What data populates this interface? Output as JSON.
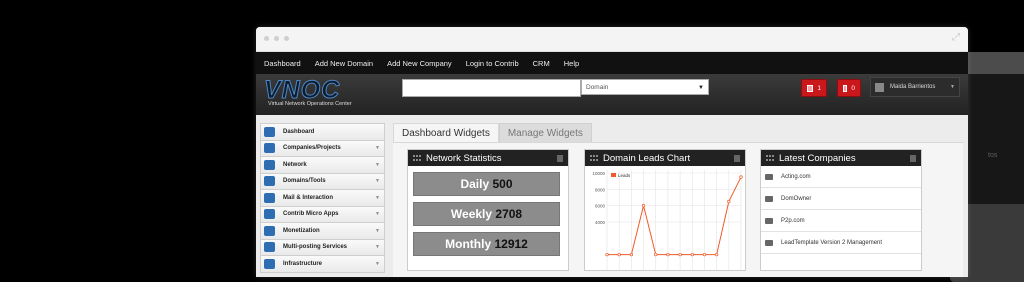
{
  "nav": [
    "Dashboard",
    "Add New Domain",
    "Add New Company",
    "Login to Contrib",
    "CRM",
    "Help"
  ],
  "logo": {
    "title": "VNOC",
    "subtitle": "Virtual Network Operations Center"
  },
  "header": {
    "select_value": "Domain",
    "badge1": "1",
    "badge2": "0",
    "user_name": "Maida Barrientos"
  },
  "sidebar": {
    "items": [
      {
        "label": "Dashboard",
        "expand": false
      },
      {
        "label": "Companies/Projects",
        "expand": true
      },
      {
        "label": "Network",
        "expand": true
      },
      {
        "label": "Domains/Tools",
        "expand": true
      },
      {
        "label": "Mail & Interaction",
        "expand": true
      },
      {
        "label": "Contrib Micro Apps",
        "expand": true
      },
      {
        "label": "Monetization",
        "expand": true
      },
      {
        "label": "Multi-posting Services",
        "expand": true
      },
      {
        "label": "Infrastructure",
        "expand": true
      }
    ]
  },
  "tabs": [
    "Dashboard Widgets",
    "Manage Widgets"
  ],
  "network_stats": {
    "title": "Network Statistics",
    "rows": [
      {
        "label": "Daily",
        "value": "500"
      },
      {
        "label": "Weekly",
        "value": "2708"
      },
      {
        "label": "Monthly",
        "value": "12912"
      }
    ]
  },
  "leads": {
    "title": "Domain Leads Chart"
  },
  "chart_data": {
    "type": "line",
    "legend": [
      "Leads"
    ],
    "y_ticks": [
      "10000",
      "8000",
      "6000",
      "4000"
    ],
    "ylim": [
      0,
      10000
    ],
    "series": [
      {
        "name": "Leads",
        "values": [
          0,
          0,
          0,
          6000,
          0,
          0,
          0,
          0,
          0,
          0,
          6500,
          9500
        ]
      }
    ],
    "color": "#f05a28"
  },
  "companies": {
    "title": "Latest Companies",
    "items": [
      "Acting.com",
      "DomOwner",
      "P2p.com",
      "LeadTemplate Version 2 Management"
    ]
  },
  "ghost_text": "tos"
}
